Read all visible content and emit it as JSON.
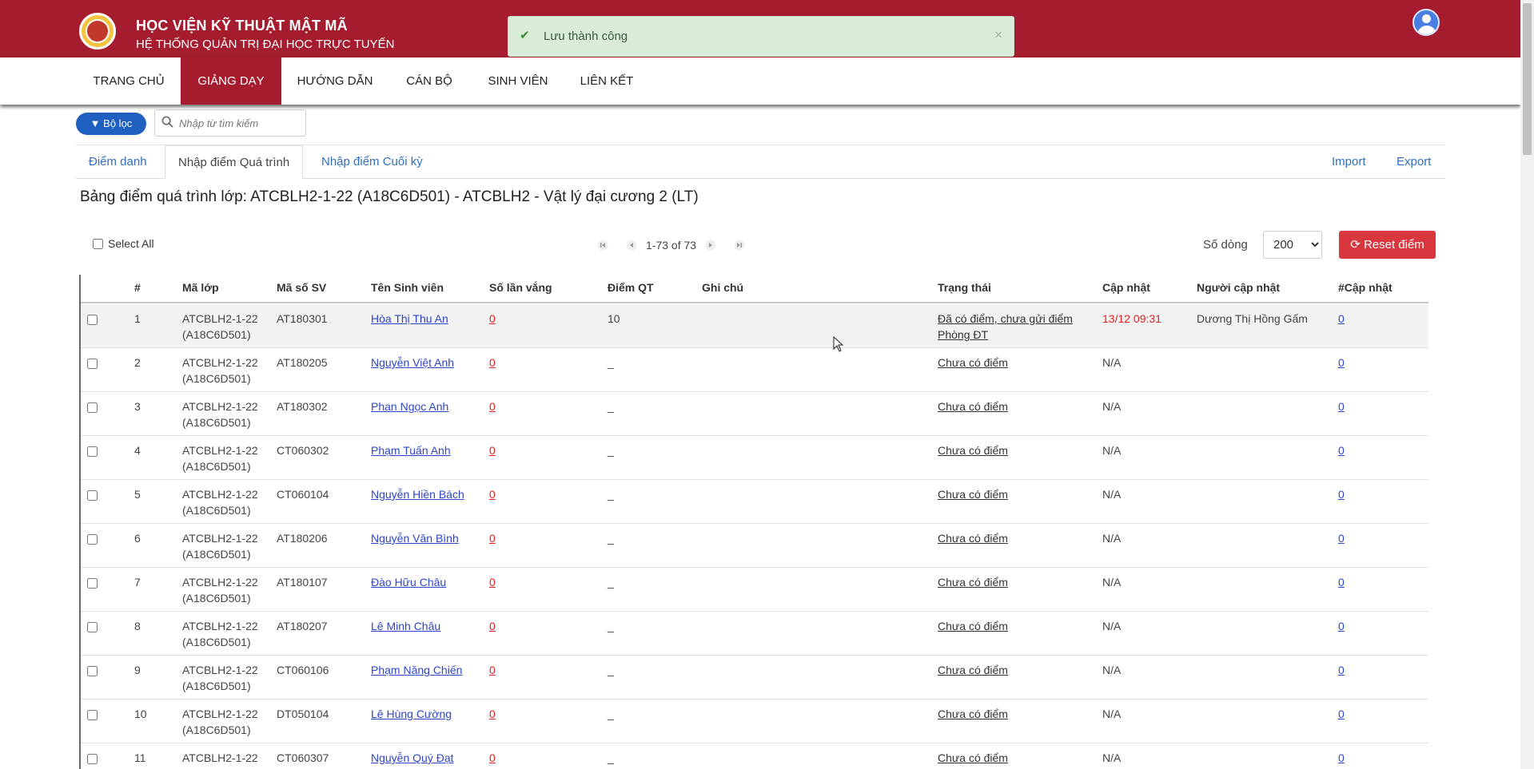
{
  "header": {
    "title": "HỌC VIỆN KỸ THUẬT MẬT MÃ",
    "subtitle": "HỆ THỐNG QUẢN TRỊ ĐẠI HỌC TRỰC TUYẾN",
    "brand_color": "#a41c2e"
  },
  "toast": {
    "message": "Lưu thành công",
    "close": "×"
  },
  "nav": {
    "items": [
      {
        "label": "TRANG CHỦ"
      },
      {
        "label": "GIẢNG DẠY"
      },
      {
        "label": "HƯỚNG DẪN"
      },
      {
        "label": "CÁN BỘ"
      },
      {
        "label": "SINH VIÊN"
      },
      {
        "label": "LIÊN KẾT"
      }
    ],
    "active": "GIẢNG DẠY"
  },
  "toolbar": {
    "filter_label": "Bộ lọc",
    "search_placeholder": "Nhập từ tìm kiếm"
  },
  "tabs": {
    "items": [
      {
        "label": "Điểm danh"
      },
      {
        "label": "Nhập điểm Quá trình"
      },
      {
        "label": "Nhập điểm Cuối kỳ"
      }
    ],
    "active": "Nhập điểm Quá trình",
    "import": "Import",
    "export": "Export"
  },
  "section_title": "Bảng điểm quá trình lớp: ATCBLH2-1-22 (A18C6D501) - ATCBLH2 - Vật lý đại cương 2 (LT)",
  "controls": {
    "select_all": "Select All",
    "pager_text": "1-73 of 73",
    "rows_label": "Số dòng",
    "rows_value": "200",
    "reset_label": "Reset điểm"
  },
  "table": {
    "headers": {
      "idx": "#",
      "class": "Mã lớp",
      "sid": "Mã số SV",
      "name": "Tên Sinh viên",
      "absent": "Số lần vắng",
      "score": "Điểm QT",
      "note": "Ghi chú",
      "status": "Trạng thái",
      "updated": "Cập nhật",
      "updater": "Người cập nhật",
      "count": "#Cập nhật"
    },
    "rows": [
      {
        "idx": "1",
        "class1": "ATCBLH2-1-22",
        "class2": "(A18C6D501)",
        "sid": "AT180301",
        "name": "Hòa Thị Thu An",
        "absent": "0",
        "score": "10",
        "status1": "Đã có điểm, chưa gửi điểm",
        "status2": "Phòng ĐT",
        "updated": "13/12 09:31",
        "updater": "Dương Thị Hồng Gấm",
        "count": "0"
      },
      {
        "idx": "2",
        "class1": "ATCBLH2-1-22",
        "class2": "(A18C6D501)",
        "sid": "AT180205",
        "name": "Nguyễn Việt Anh",
        "absent": "0",
        "score": "_",
        "status1": "Chưa có điểm",
        "status2": "",
        "updated": "N/A",
        "updater": "",
        "count": "0"
      },
      {
        "idx": "3",
        "class1": "ATCBLH2-1-22",
        "class2": "(A18C6D501)",
        "sid": "AT180302",
        "name": "Phan Ngọc Anh",
        "absent": "0",
        "score": "_",
        "status1": "Chưa có điểm",
        "status2": "",
        "updated": "N/A",
        "updater": "",
        "count": "0"
      },
      {
        "idx": "4",
        "class1": "ATCBLH2-1-22",
        "class2": "(A18C6D501)",
        "sid": "CT060302",
        "name": "Phạm Tuấn Anh",
        "absent": "0",
        "score": "_",
        "status1": "Chưa có điểm",
        "status2": "",
        "updated": "N/A",
        "updater": "",
        "count": "0"
      },
      {
        "idx": "5",
        "class1": "ATCBLH2-1-22",
        "class2": "(A18C6D501)",
        "sid": "CT060104",
        "name": "Nguyễn Hiền Bách",
        "absent": "0",
        "score": "_",
        "status1": "Chưa có điểm",
        "status2": "",
        "updated": "N/A",
        "updater": "",
        "count": "0"
      },
      {
        "idx": "6",
        "class1": "ATCBLH2-1-22",
        "class2": "(A18C6D501)",
        "sid": "AT180206",
        "name": "Nguyễn Văn Bình",
        "absent": "0",
        "score": "_",
        "status1": "Chưa có điểm",
        "status2": "",
        "updated": "N/A",
        "updater": "",
        "count": "0"
      },
      {
        "idx": "7",
        "class1": "ATCBLH2-1-22",
        "class2": "(A18C6D501)",
        "sid": "AT180107",
        "name": "Đào Hữu Châu",
        "absent": "0",
        "score": "_",
        "status1": "Chưa có điểm",
        "status2": "",
        "updated": "N/A",
        "updater": "",
        "count": "0"
      },
      {
        "idx": "8",
        "class1": "ATCBLH2-1-22",
        "class2": "(A18C6D501)",
        "sid": "AT180207",
        "name": "Lê Minh Châu",
        "absent": "0",
        "score": "_",
        "status1": "Chưa có điểm",
        "status2": "",
        "updated": "N/A",
        "updater": "",
        "count": "0"
      },
      {
        "idx": "9",
        "class1": "ATCBLH2-1-22",
        "class2": "(A18C6D501)",
        "sid": "CT060106",
        "name": "Phạm Năng Chiến",
        "absent": "0",
        "score": "_",
        "status1": "Chưa có điểm",
        "status2": "",
        "updated": "N/A",
        "updater": "",
        "count": "0"
      },
      {
        "idx": "10",
        "class1": "ATCBLH2-1-22",
        "class2": "(A18C6D501)",
        "sid": "DT050104",
        "name": "Lê Hùng Cường",
        "absent": "0",
        "score": "_",
        "status1": "Chưa có điểm",
        "status2": "",
        "updated": "N/A",
        "updater": "",
        "count": "0"
      },
      {
        "idx": "11",
        "class1": "ATCBLH2-1-22",
        "class2": "",
        "sid": "CT060307",
        "name": "Nguyễn Quý Đạt",
        "absent": "0",
        "score": "_",
        "status1": "Chưa có điểm",
        "status2": "",
        "updated": "N/A",
        "updater": "",
        "count": "0"
      }
    ]
  }
}
